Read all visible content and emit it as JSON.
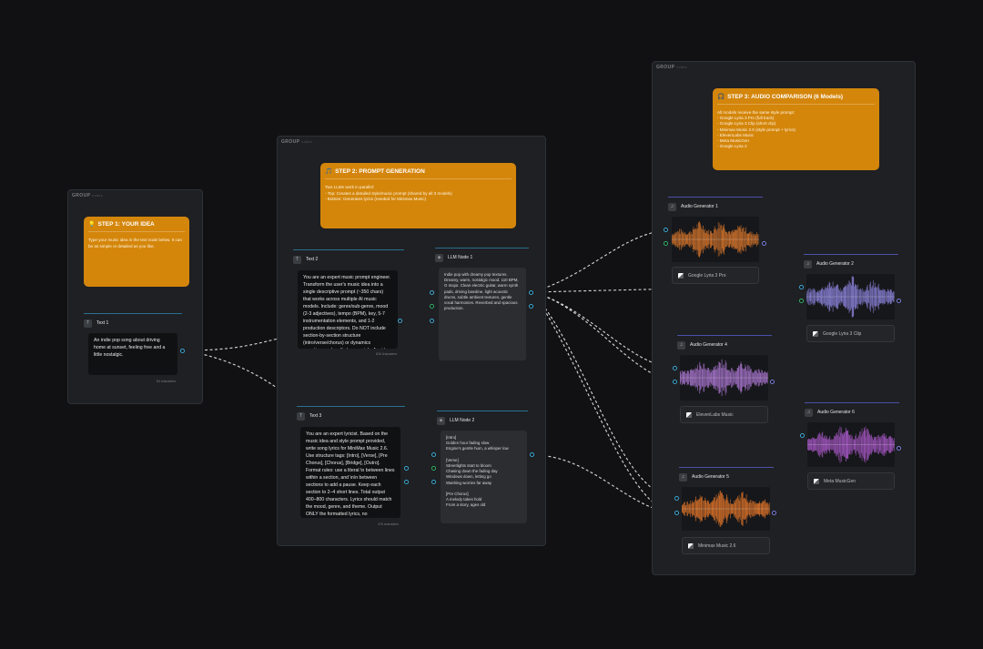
{
  "groups": [
    {
      "label": "GROUP",
      "sub": "nodes"
    },
    {
      "label": "GROUP",
      "sub": "nodes"
    },
    {
      "label": "GROUP",
      "sub": "nodes"
    }
  ],
  "notes": {
    "step1": {
      "title": "STEP 1: YOUR IDEA",
      "icon": "lightbulb-icon",
      "body": "Type your music idea in the text node below. It can be as simple or detailed as you like."
    },
    "step2": {
      "title": "STEP 2: PROMPT GENERATION",
      "icon": "music-note-icon",
      "lines": [
        "Two LLMs work in parallel:",
        "- Top: Creates a detailed style/music prompt (shared by all 3 models)",
        "- Bottom: Generates lyrics (needed for Minimax Music)"
      ]
    },
    "step3": {
      "title": "STEP 3: AUDIO COMPARISON (6 Models)",
      "icon": "headphones-icon",
      "lines": [
        "All models receive the same style prompt:",
        "- Google Lyria 3 Pro (full track)",
        "- Google Lyria 3 Clip (short clip)",
        "- Minimax Music 2.6 (style prompt + lyrics)",
        "- ElevenLabs Music",
        "- Meta MusicGen",
        "- Google Lyria 2"
      ]
    }
  },
  "text1": {
    "title": "Text 1",
    "value": "An indie pop song about driving home at sunset, feeling free and a little nostalgic.",
    "count": "84 characters"
  },
  "text2": {
    "title": "Text 2",
    "value": "You are an expert music prompt engineer. Transform the user's music idea into a single descriptive prompt (~350 chars) that works across multiple AI music models. Include: genre/sub-genre, mood (2-3 adjectives), tempo (BPM), key, 5-7 instrumentation elements, and 1-2 production descriptors. Do NOT include section-by-section structure (intro/verse/chorus) or dynamics narratives — handled separately. Avoid",
    "count": "816 characters"
  },
  "text3": {
    "title": "Text 3",
    "value": "You are an expert lyricist. Based on the music idea and style prompt provided, write song lyrics for MiniMax Music 2.6. Use structure tags: [Intro], [Verse], [Pre Chorus], [Chorus], [Bridge], [Outro]. Format rules: use a literal \\n between lines within a section, and \\n\\n between sections to add a pause. Keep each section to 2–4 short lines. Total output 400–800 characters. Lyrics should match the mood, genre, and theme. Output ONLY the formatted lyrics, no explanations.",
    "count": "476 characters"
  },
  "llm1": {
    "title": "LLM Node 1",
    "output": "Indie pop with dreamy pop textures. Dreamy, warm, nostalgic mood. 110 BPM, G major. Clean electric guitar, warm synth pads, driving bassline, light acoustic drums, subtle ambient textures, gentle vocal harmonies. Reverbed and spacious production."
  },
  "llm2": {
    "title": "LLM Node 2",
    "output": "[Intro]\nGolden hour fading slow\nEngine's gentle hum, a whisper low\n\n[Verse]\nStreetlights start to bloom\nChasing down the fading day\nWindows down, letting go\nWashing worries far away\n\n[Pre Chorus]\nA melody takes hold\nFrom a story, ages old"
  },
  "audio": [
    {
      "title": "Audio Generator 1",
      "model": "Google Lyria 3 Pro",
      "color": "#e07a2c"
    },
    {
      "title": "Audio Generator 2",
      "model": "Google Lyria 3 Clip",
      "color": "#8e86e0"
    },
    {
      "title": "Audio Generator 4",
      "model": "ElevenLabs Music",
      "color": "#b07ad8"
    },
    {
      "title": "Audio Generator 5",
      "model": "Minimax Music 2.6",
      "color": "#e8782a"
    },
    {
      "title": "Audio Generator 6",
      "model": "Meta MusicGen",
      "color": "#b05cd0"
    }
  ],
  "icons": {
    "text": "text-icon",
    "llm": "chip-icon",
    "audio": "speaker-icon",
    "model": "model-icon"
  }
}
